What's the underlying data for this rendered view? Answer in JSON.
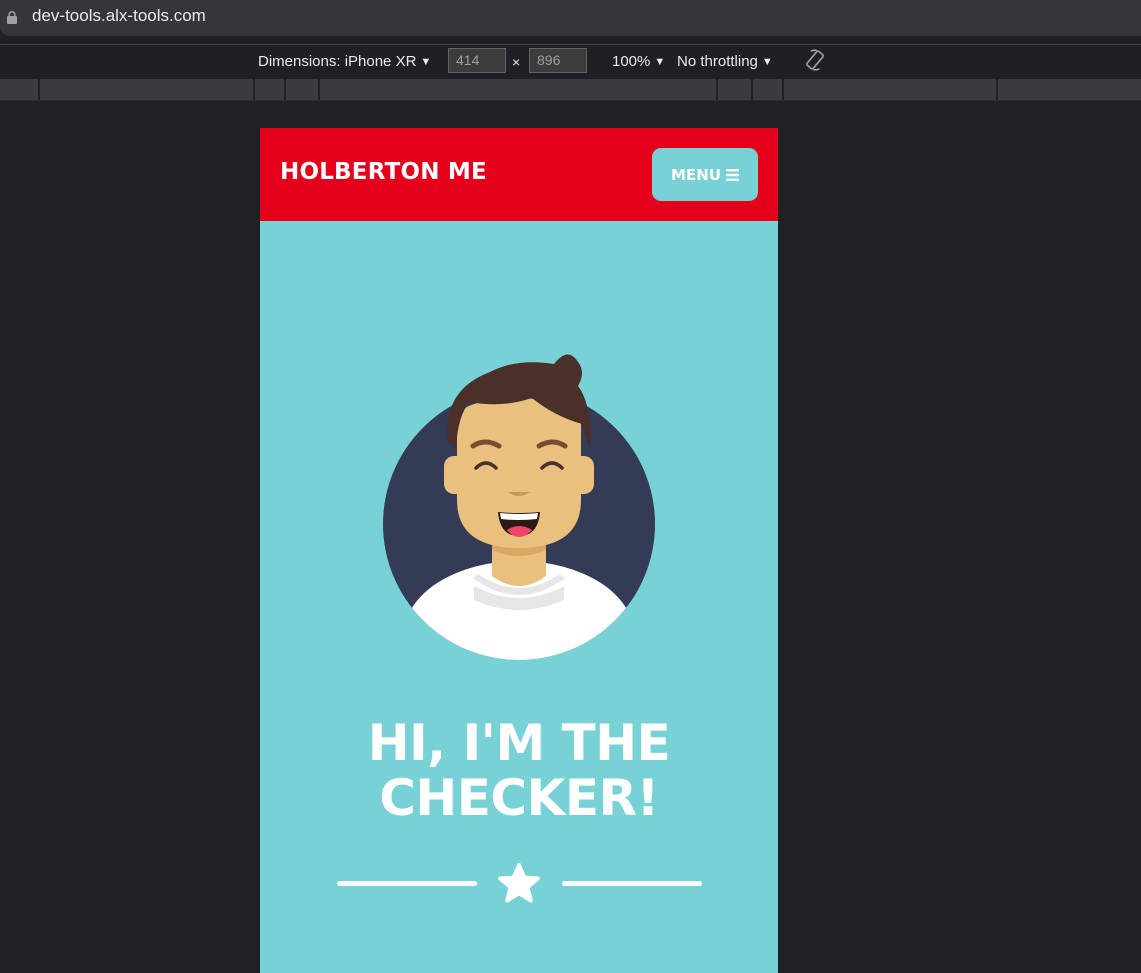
{
  "browser": {
    "url": "dev-tools.alx-tools.com"
  },
  "devtools": {
    "dimensions_label": "Dimensions: iPhone XR",
    "width": "414",
    "height": "896",
    "times": "×",
    "zoom": "100%",
    "throttling": "No throttling",
    "icons": [
      "lock-icon",
      "rotate-icon"
    ]
  },
  "page": {
    "brand": "HOLBERTON ME",
    "menu_label": "MENU",
    "headline_line1": "HI, I'M THE",
    "headline_line2": "CHECKER!",
    "colors": {
      "header": "#e4001b",
      "background": "#77d1d5",
      "text": "#ffffff",
      "avatar_circle": "#333b57",
      "hair": "#4b2f29",
      "skin": "#e9c07d"
    },
    "icons": [
      "menu-icon",
      "avatar-illustration",
      "star-icon"
    ]
  }
}
